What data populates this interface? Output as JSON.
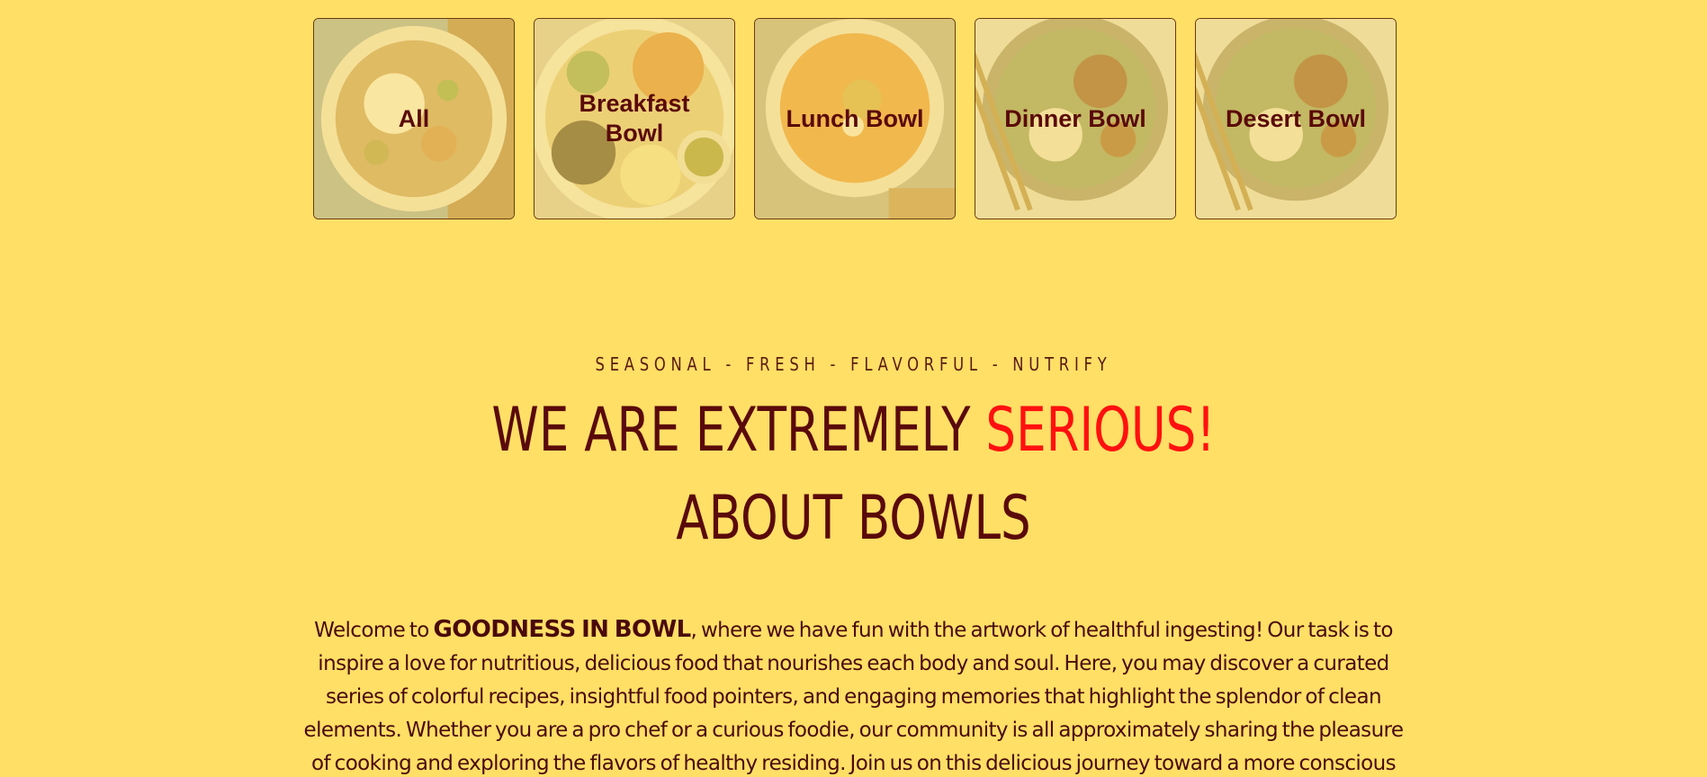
{
  "categories": [
    {
      "label": "All"
    },
    {
      "label": "Breakfast Bowl"
    },
    {
      "label": "Lunch Bowl"
    },
    {
      "label": "Dinner Bowl"
    },
    {
      "label": "Desert Bowl"
    }
  ],
  "intro": {
    "tagline": "SEASONAL - FRESH - FLAVORFUL - NUTRIFY",
    "headline_part1": "WE ARE EXTREMELY ",
    "headline_accent": "SERIOUS!",
    "headline_line2": "ABOUT BOWLS",
    "body_prefix": "Welcome to ",
    "brand": "GOODNESS IN BOWL",
    "body_rest": ", where we have fun with the artwork of healthful ingesting! Our task is to inspire a love for nutritious, delicious food that nourishes each body and soul. Here, you may discover a curated series of colorful recipes, insightful food pointers, and engaging memories that highlight the splendor of clean elements. Whether you are a pro chef or a curious foodie, our community is all approximately sharing the pleasure of cooking and exploring the flavors of healthy residing. Join us on this delicious journey toward a more conscious and tasty way of life!"
  },
  "colors": {
    "background": "#ffdf66",
    "text": "#5a0a0a",
    "accent": "#ff1010"
  }
}
